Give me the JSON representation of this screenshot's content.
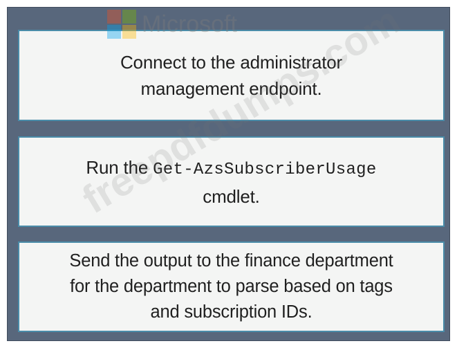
{
  "logo": {
    "text": "Microsoft",
    "colors": [
      "#f25022",
      "#7fba00",
      "#00a4ef",
      "#ffb900"
    ]
  },
  "watermark": {
    "text": "freepdfdumps.com"
  },
  "steps": [
    {
      "line_1": "Connect to the administrator",
      "line_2": "management endpoint."
    },
    {
      "prefix": "Run the ",
      "command": "Get-AzsSubscriberUsage",
      "suffix": "cmdlet."
    },
    {
      "line_1": "Send the output to the finance department",
      "line_2": "for the department to parse based on tags",
      "line_3": "and subscription IDs."
    }
  ]
}
